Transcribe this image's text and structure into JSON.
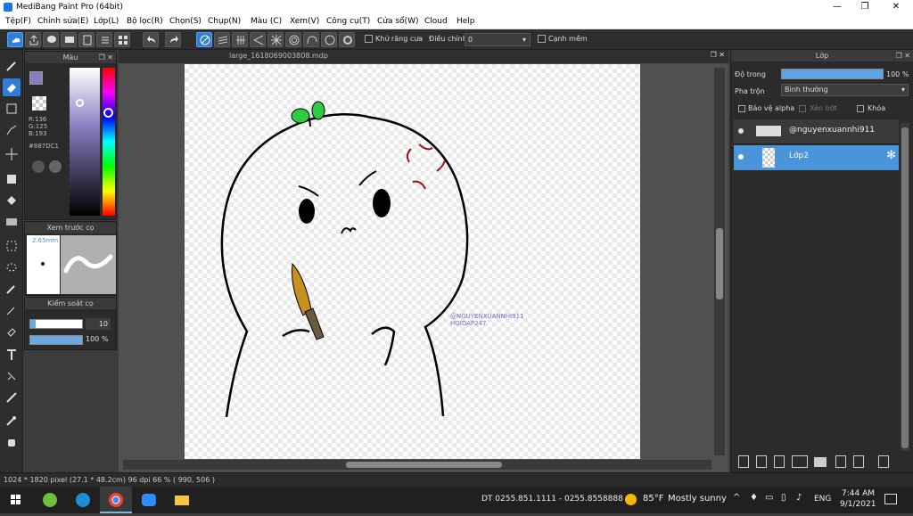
{
  "window": {
    "title": "MediBang Paint Pro (64bit)",
    "minimize": "—",
    "maximize": "❐",
    "close": "✕"
  },
  "menu": {
    "items": [
      "Tệp(F)",
      "Chỉnh sửa(E)",
      "Lớp(L)",
      "Bộ lọc(R)",
      "Chọn(S)",
      "Chụp(N)",
      "Màu (C)",
      "Xem(V)",
      "Công cụ(T)",
      "Cửa sổ(W)",
      "Cloud",
      "Help"
    ]
  },
  "toolbar": {
    "antialias_label": "Khử răng cưa",
    "adjust_label": "Điều chỉnh",
    "adjust_value": "0",
    "edge_label": "Cạnh mềm"
  },
  "color_panel": {
    "title": "Màu",
    "r": "R:136",
    "g": "G:125",
    "b": "B:193",
    "hex": "#887DC1",
    "main_color": "#887DC1",
    "alt_color": "#ffffff"
  },
  "brush_preview": {
    "title": "Xem trước cọ",
    "size": "2.65mm"
  },
  "brush_control": {
    "title": "Kiểm soát cọ",
    "size_value": "10",
    "opacity_value": "100 %",
    "size_fraction": 0.1,
    "opacity_fraction": 1.0
  },
  "document": {
    "tab_name": "large_1618069003808.mdp",
    "watermark_line1": "@NGUYENXUANNHI911",
    "watermark_line2": "HOIDAP247"
  },
  "layer_panel": {
    "title": "Lớp",
    "opacity_label": "Độ trong",
    "opacity_value": "100 %",
    "opacity_fraction": 1.0,
    "blend_label": "Pha trộn",
    "blend_value": "Bình thường",
    "protect_alpha": "Bảo vệ alpha",
    "clipping": "Xén bớt",
    "lock": "Khóa",
    "layers": [
      {
        "name": "@nguyenxuannhi911",
        "selected": false
      },
      {
        "name": "Lớp2",
        "selected": true
      }
    ]
  },
  "status": {
    "text": "1024 * 1820 pixel   (27.1 * 48.2cm)   96 dpi   66 %   ( 990, 506 )"
  },
  "taskbar": {
    "phone": "DT 0255.851.1111 - 0255.8558888",
    "weather_temp": "85°F",
    "weather_desc": "Mostly sunny",
    "lang": "ENG",
    "time": "7:44 AM",
    "date": "9/1/2021"
  }
}
